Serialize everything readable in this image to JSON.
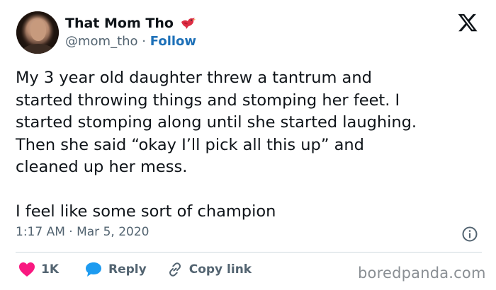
{
  "author": {
    "display_name": "That Mom Tho",
    "handle": "@mom_tho",
    "separator": "·",
    "follow_label": "Follow"
  },
  "tweet": {
    "text": "My 3 year old daughter threw a tantrum and\nstarted throwing things and stomping her feet. I\nstarted stomping along until she started laughing.\nThen she said “okay I’ll pick all this up” and\ncleaned up her mess.\n\nI feel like some sort of champion",
    "timestamp": "1:17 AM · Mar 5, 2020"
  },
  "actions": {
    "like_count": "1K",
    "reply_label": "Reply",
    "copy_link_label": "Copy link"
  },
  "watermark": "boredpanda.com",
  "icons": {
    "bird": "red-bird-emoji-icon",
    "x_logo": "x-logo-icon",
    "info": "info-icon",
    "heart": "heart-icon",
    "reply": "speech-bubble-icon",
    "link": "link-icon"
  },
  "colors": {
    "text": "#0f1419",
    "secondary": "#536471",
    "follow": "#1d70b8",
    "heart": "#f91880",
    "reply": "#1d9bf0",
    "divider": "#cfd9de"
  }
}
